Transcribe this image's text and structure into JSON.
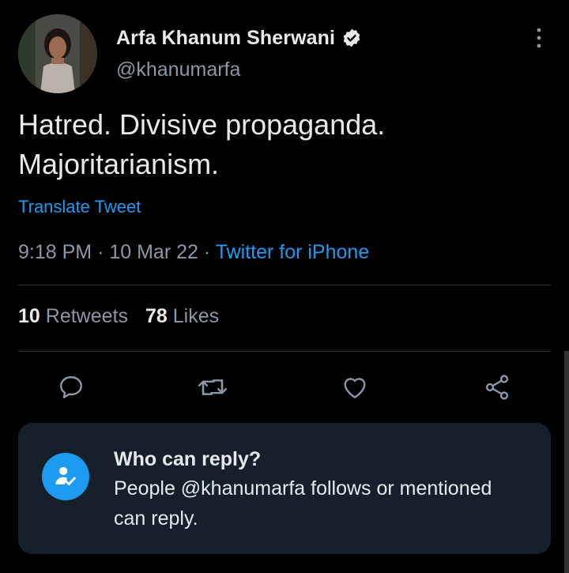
{
  "author": {
    "display_name": "Arfa Khanum Sherwani",
    "handle": "@khanumarfa",
    "verified": true
  },
  "tweet": {
    "text": "Hatred. Divisive propaganda.\nMajoritarianism.",
    "translate_label": "Translate Tweet",
    "time": "9:18 PM",
    "date": "10 Mar 22",
    "separator": "·",
    "source": "Twitter for iPhone"
  },
  "stats": {
    "retweets_count": "10",
    "retweets_label": "Retweets",
    "likes_count": "78",
    "likes_label": "Likes"
  },
  "actions": {
    "icons": [
      "reply-icon",
      "retweet-icon",
      "like-icon",
      "share-icon"
    ]
  },
  "reply_settings": {
    "title": "Who can reply?",
    "description": "People @khanumarfa follows or mentioned can reply."
  },
  "colors": {
    "background": "#000000",
    "accent": "#1d9bf0",
    "secondary_text": "#8b98a5",
    "card_background": "#15202b"
  }
}
